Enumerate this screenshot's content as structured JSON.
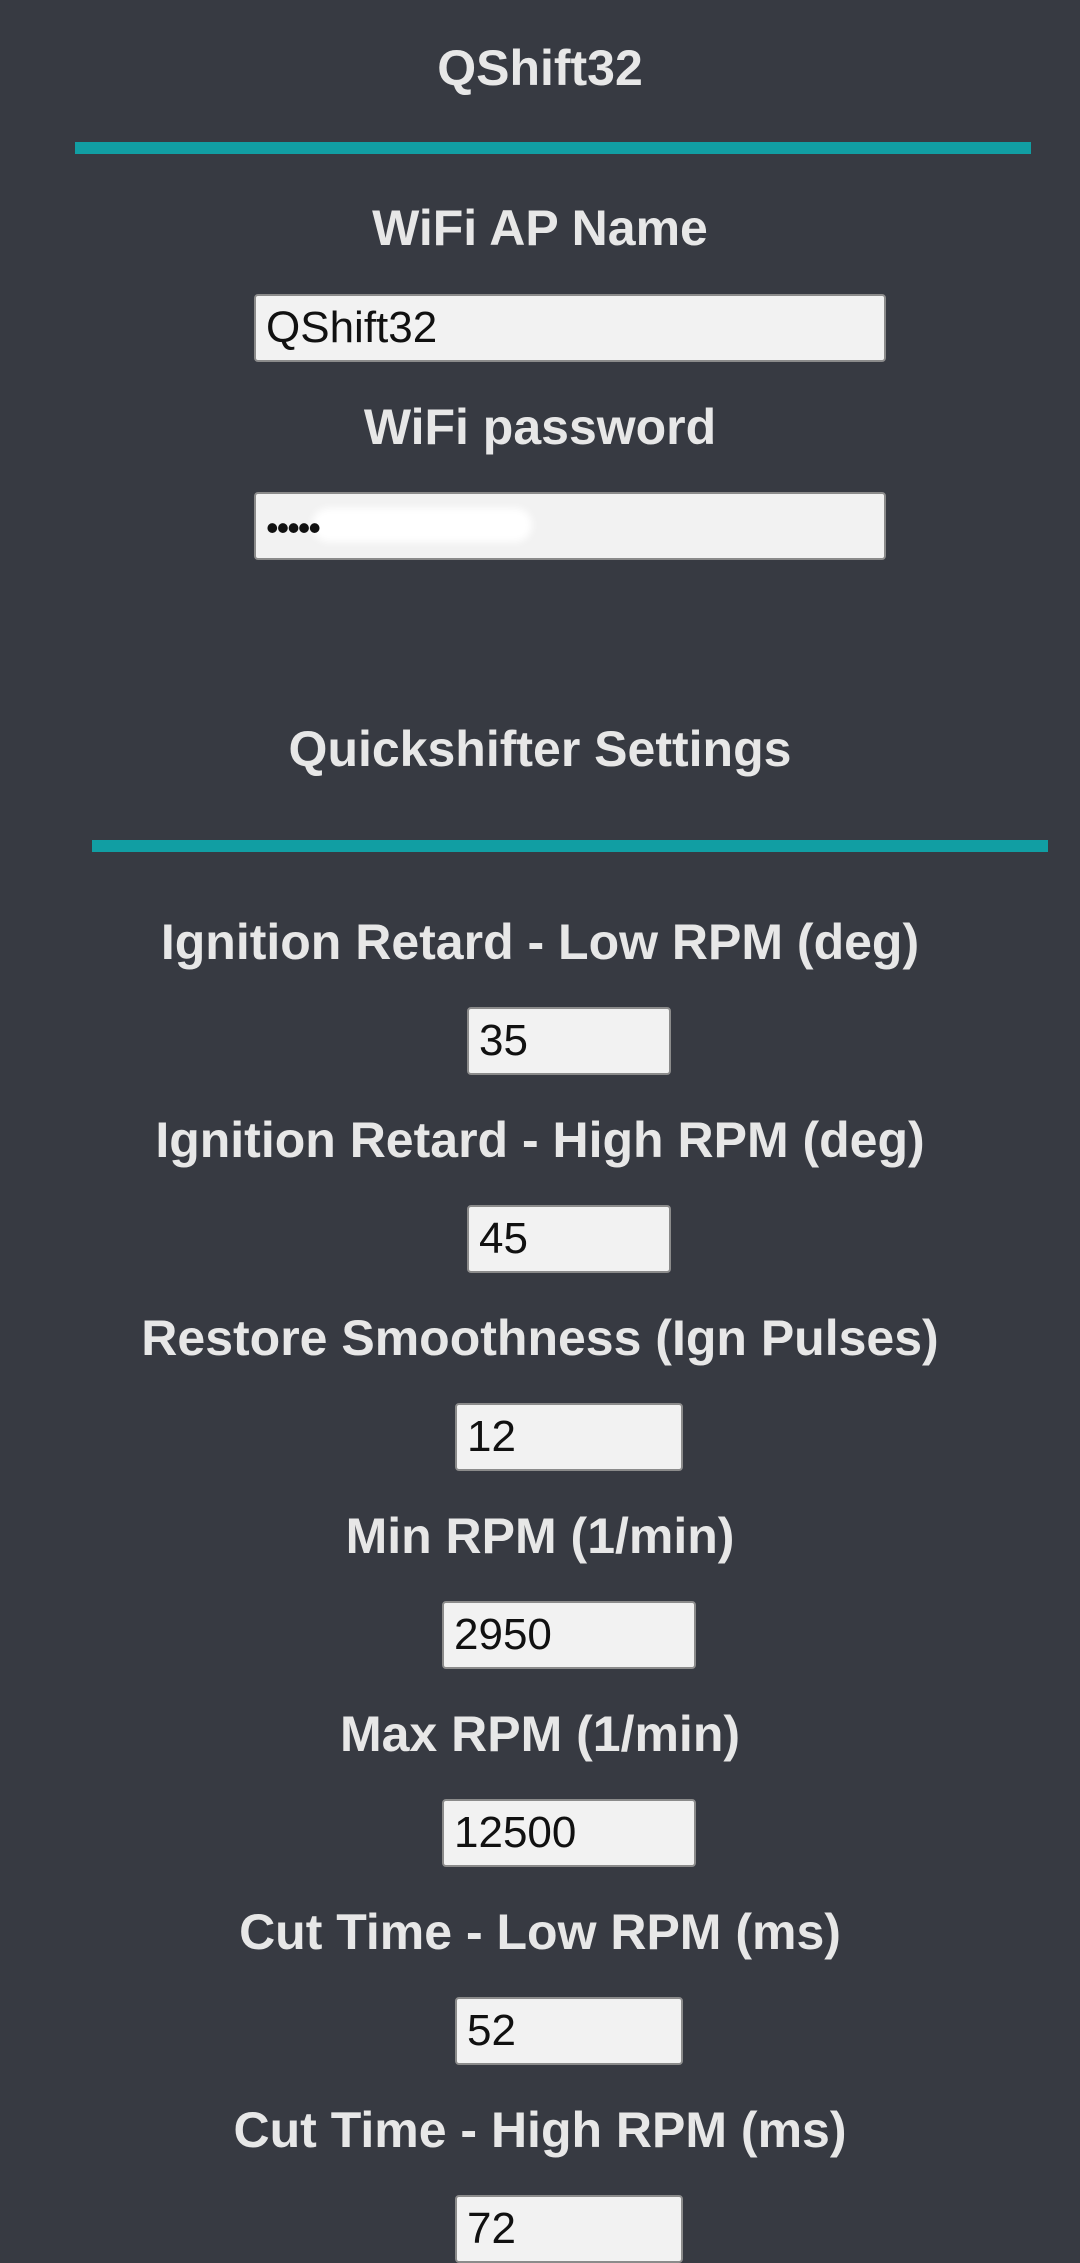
{
  "header": {
    "title": "QShift32"
  },
  "wifi": {
    "ap_name_label": "WiFi AP Name",
    "ap_name_value": "QShift32",
    "password_label": "WiFi password",
    "password_value": "•••••"
  },
  "quickshifter": {
    "section_title": "Quickshifter Settings",
    "ign_retard_low_label": "Ignition Retard - Low RPM (deg)",
    "ign_retard_low_value": "35",
    "ign_retard_high_label": "Ignition Retard - High RPM (deg)",
    "ign_retard_high_value": "45",
    "restore_smoothness_label": "Restore Smoothness (Ign Pulses)",
    "restore_smoothness_value": "12",
    "min_rpm_label": "Min RPM (1/min)",
    "min_rpm_value": "2950",
    "max_rpm_label": "Max RPM (1/min)",
    "max_rpm_value": "12500",
    "cut_time_low_label": "Cut Time - Low RPM (ms)",
    "cut_time_low_value": "52",
    "cut_time_high_label": "Cut Time - High RPM (ms)",
    "cut_time_high_value": "72"
  },
  "colors": {
    "background": "#373a42",
    "accent_rule": "#119ea3",
    "label_text": "#e7e7e7",
    "field_background": "#f2f2f2"
  }
}
